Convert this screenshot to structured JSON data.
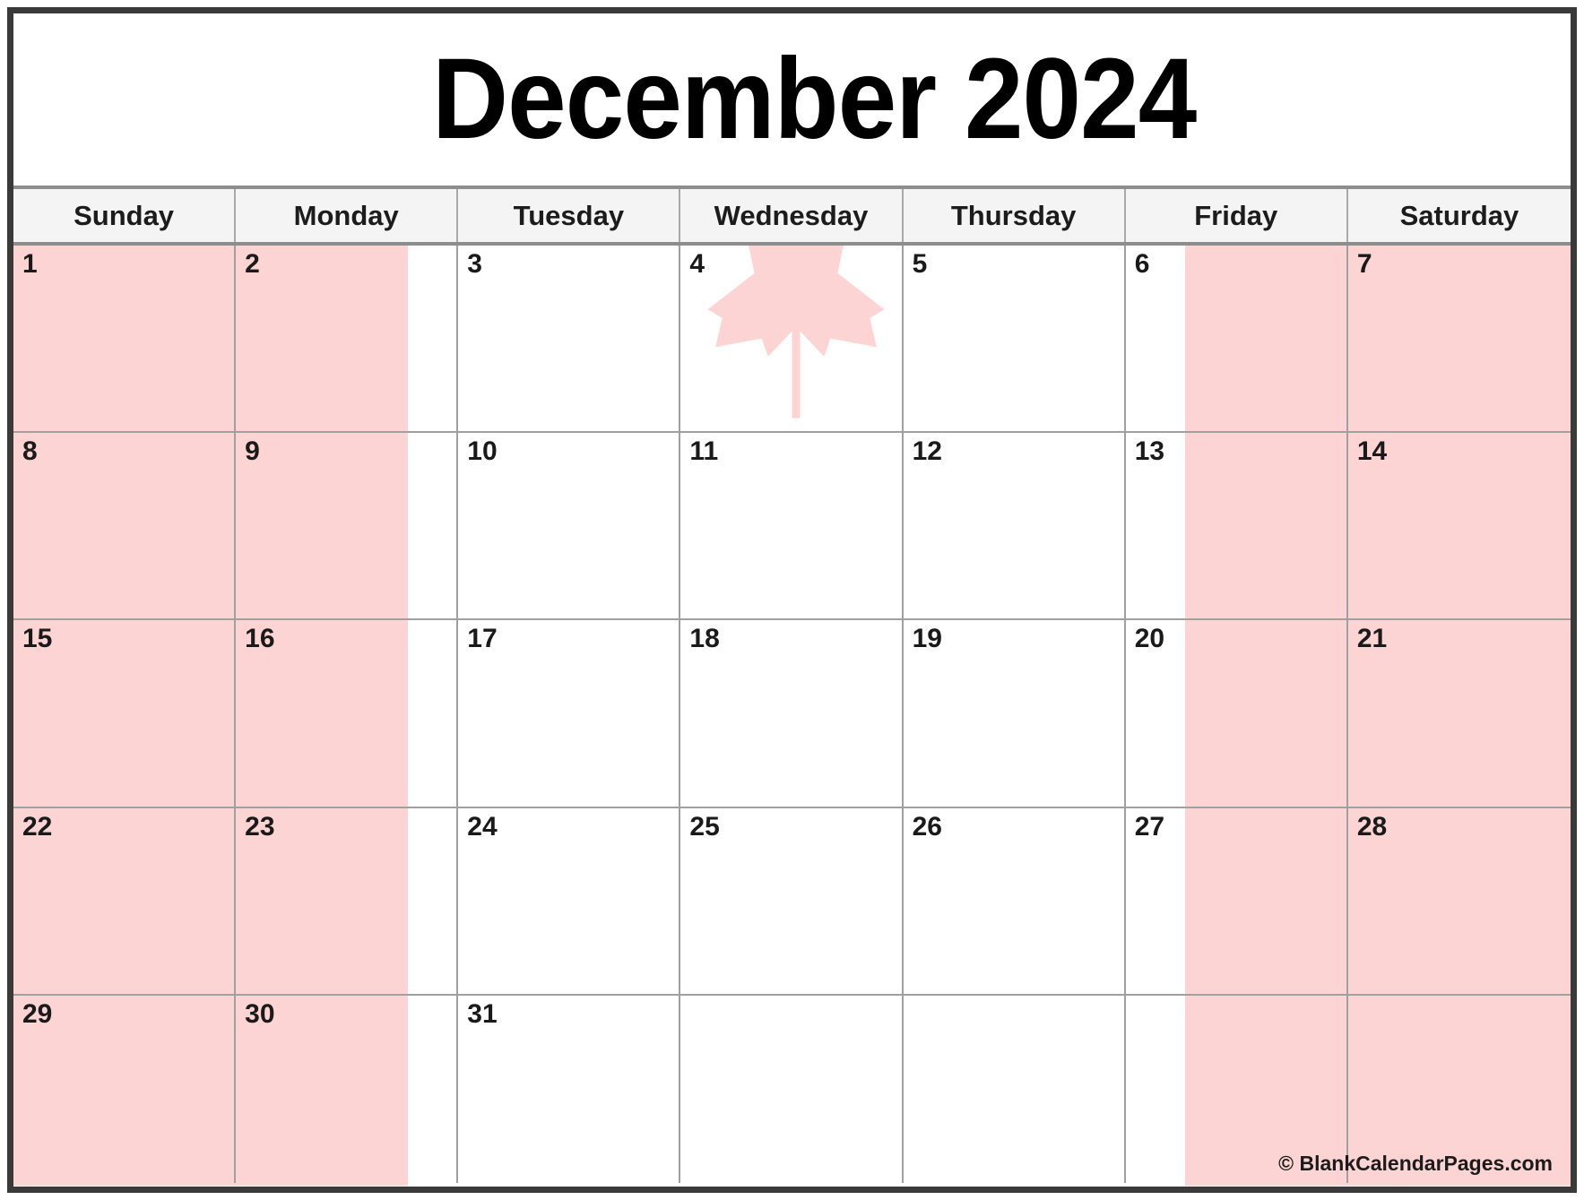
{
  "calendar": {
    "title": "December 2024",
    "month_name": "December",
    "year": "2024",
    "weekdays": [
      {
        "label": "Sunday"
      },
      {
        "label": "Monday"
      },
      {
        "label": "Tuesday"
      },
      {
        "label": "Wednesday"
      },
      {
        "label": "Thursday"
      },
      {
        "label": "Friday"
      },
      {
        "label": "Saturday"
      }
    ],
    "weeks": [
      [
        "1",
        "2",
        "3",
        "4",
        "5",
        "6",
        "7"
      ],
      [
        "8",
        "9",
        "10",
        "11",
        "12",
        "13",
        "14"
      ],
      [
        "15",
        "16",
        "17",
        "18",
        "19",
        "20",
        "21"
      ],
      [
        "22",
        "23",
        "24",
        "25",
        "26",
        "27",
        "28"
      ],
      [
        "29",
        "30",
        "31",
        "",
        "",
        "",
        ""
      ]
    ],
    "days": [
      "1",
      "2",
      "3",
      "4",
      "5",
      "6",
      "7",
      "8",
      "9",
      "10",
      "11",
      "12",
      "13",
      "14",
      "15",
      "16",
      "17",
      "18",
      "19",
      "20",
      "21",
      "22",
      "23",
      "24",
      "25",
      "26",
      "27",
      "28",
      "29",
      "30",
      "31",
      "",
      "",
      "",
      ""
    ],
    "first_day_column": "Sunday",
    "total_days": 31,
    "rows": 5
  },
  "background": {
    "motif": "canadian-flag-maple-leaf",
    "tint_color": "#fcd4d4",
    "field_color": "#ffffff"
  },
  "footer": {
    "credit": "© BlankCalendarPages.com"
  },
  "colors": {
    "frame_border": "#3b3a3a",
    "grid_line": "#a0a0a0",
    "header_band": "#f4f4f4",
    "header_divider": "#8d8d8d",
    "text": "#1a1a1a",
    "flag_pink": "#fcd4d4"
  }
}
